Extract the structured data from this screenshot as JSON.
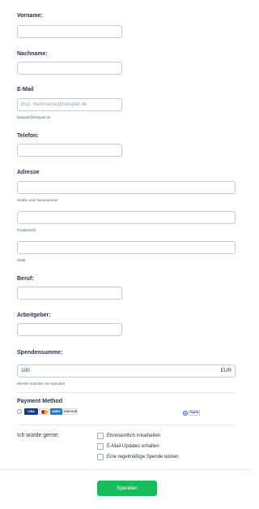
{
  "form": {
    "vorname": {
      "label": "Vorname:",
      "value": ""
    },
    "nachname": {
      "label": "Nachname:",
      "value": ""
    },
    "email": {
      "label": "E-Mail",
      "placeholder": "Bsp. meinname@beispiel.de",
      "sublabel": "beispiel@beispiel.de"
    },
    "telefon": {
      "label": "Telefon:",
      "value": ""
    },
    "adresse": {
      "label": "Adresse",
      "street_sublabel": "Straße und Hausnummer",
      "zip_sublabel": "Postleitzahl",
      "city_sublabel": "Stadt"
    },
    "beruf": {
      "label": "Beruf:",
      "value": ""
    },
    "arbeitgeber": {
      "label": "Arbeitgeber:",
      "value": ""
    },
    "spendensumme": {
      "label": "Spendensumme:",
      "value": "100",
      "currency": "EUR",
      "sublabel": "Wieviel möchten Sie spenden"
    },
    "payment": {
      "label": "Payment Method",
      "cards": [
        "VISA",
        "MC",
        "AMEX",
        "DISCOVER"
      ],
      "paypal": "PayPal",
      "selected": "paypal"
    },
    "interests": {
      "label": "Ich würde gerne:",
      "options": [
        "Ehrenamtlich mitarbeiten",
        "E-Mail-Updates erhalten",
        "Eine regelmäßige Spende leisten"
      ]
    },
    "submit_label": "Spenden"
  },
  "colors": {
    "accent": "#18bd5b",
    "border": "#c3cad8",
    "text": "#2c3345",
    "radio_active": "#2e69ff"
  }
}
